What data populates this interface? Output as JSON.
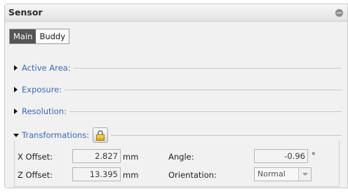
{
  "panel": {
    "title": "Sensor"
  },
  "tabs": [
    {
      "label": "Main",
      "active": true
    },
    {
      "label": "Buddy",
      "active": false
    }
  ],
  "sections": [
    {
      "label": "Active Area:",
      "expanded": false
    },
    {
      "label": "Exposure:",
      "expanded": false
    },
    {
      "label": "Resolution:",
      "expanded": false
    },
    {
      "label": "Transformations:",
      "expanded": true
    }
  ],
  "transformations": {
    "x_offset": {
      "label": "X Offset:",
      "value": "2.827",
      "unit": "mm"
    },
    "z_offset": {
      "label": "Z Offset:",
      "value": "13.395",
      "unit": "mm"
    },
    "angle": {
      "label": "Angle:",
      "value": "-0.96",
      "unit": "°"
    },
    "orientation": {
      "label": "Orientation:",
      "value": "Normal"
    }
  },
  "icons": {
    "collapse": "minus-circle-icon",
    "lock": "lock-icon",
    "section_collapsed": "triangle-right-icon",
    "section_expanded": "triangle-down-icon",
    "dropdown": "chevron-down-icon"
  },
  "colors": {
    "section_label": "#3a69b4",
    "active_tab_bg": "#555555",
    "lock_gold": "#e3b12a"
  }
}
